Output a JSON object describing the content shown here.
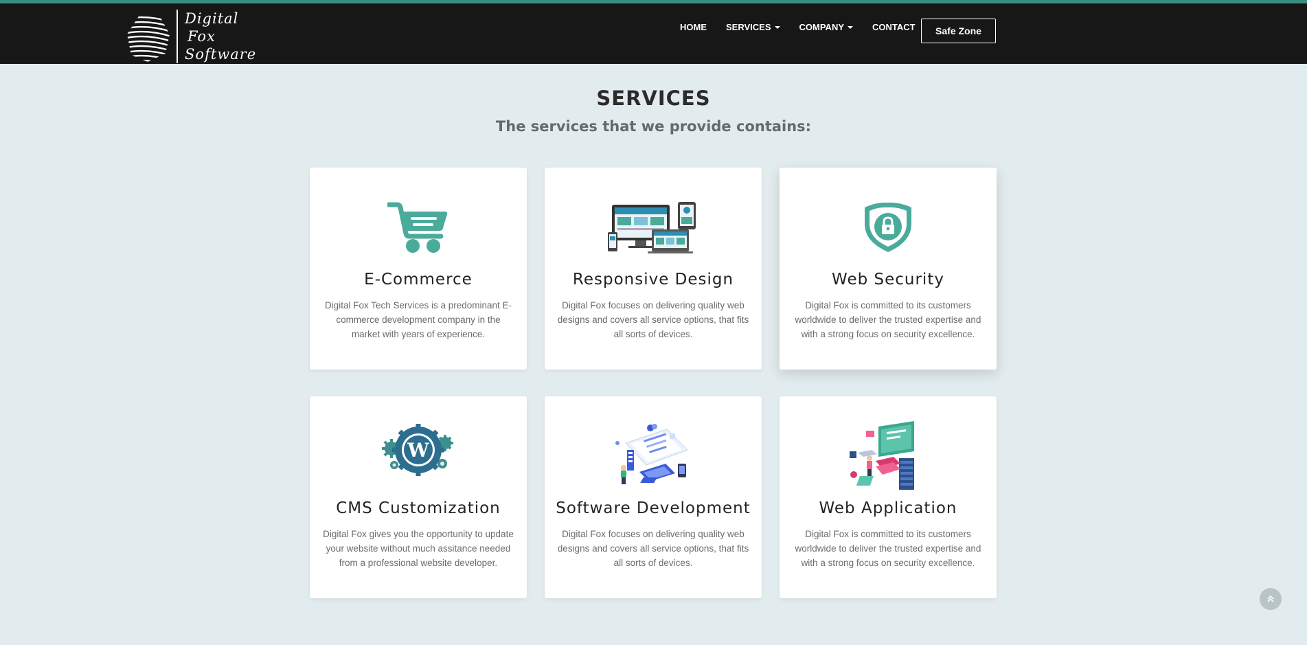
{
  "brand": {
    "logo_lines": [
      "Digital",
      "Fox",
      "Software"
    ],
    "accent_color": "#4aab9b",
    "navbar_color": "#171717",
    "background_color": "#e2ecee"
  },
  "nav": {
    "items": [
      {
        "label": "HOME",
        "has_dropdown": false
      },
      {
        "label": "SERVICES",
        "has_dropdown": true
      },
      {
        "label": "COMPANY",
        "has_dropdown": true
      },
      {
        "label": "CONTACT",
        "has_dropdown": false
      }
    ],
    "safe_zone_label": "Safe Zone"
  },
  "section": {
    "title": "SERVICES",
    "subtitle": "The services that we provide contains:"
  },
  "services": [
    {
      "title": "E-Commerce",
      "text": "Digital Fox Tech Services is a predominant E-commerce development company in the market with years of experience.",
      "icon": "shopping-cart-icon"
    },
    {
      "title": "Responsive Design",
      "text": "Digital Fox focuses on delivering quality web designs and covers all service options, that fits all sorts of devices.",
      "icon": "responsive-devices-icon"
    },
    {
      "title": "Web Security",
      "text": "Digital Fox is committed to its customers worldwide to deliver the trusted expertise and with a strong focus on security excellence.",
      "icon": "shield-lock-icon"
    },
    {
      "title": "CMS Customization",
      "text": "Digital Fox gives you the opportunity to update your website without much assitance needed from a professional website developer.",
      "icon": "wordpress-gears-icon"
    },
    {
      "title": "Software Development",
      "text": "Digital Fox focuses on delivering quality web designs and covers all service options, that fits all sorts of devices.",
      "icon": "software-development-illustration-icon"
    },
    {
      "title": "Web Application",
      "text": "Digital Fox is committed to its customers worldwide to deliver the trusted expertise and with a strong focus on security excellence.",
      "icon": "web-application-illustration-icon"
    }
  ],
  "scroll_top_icon": "double-chevron-up-icon"
}
